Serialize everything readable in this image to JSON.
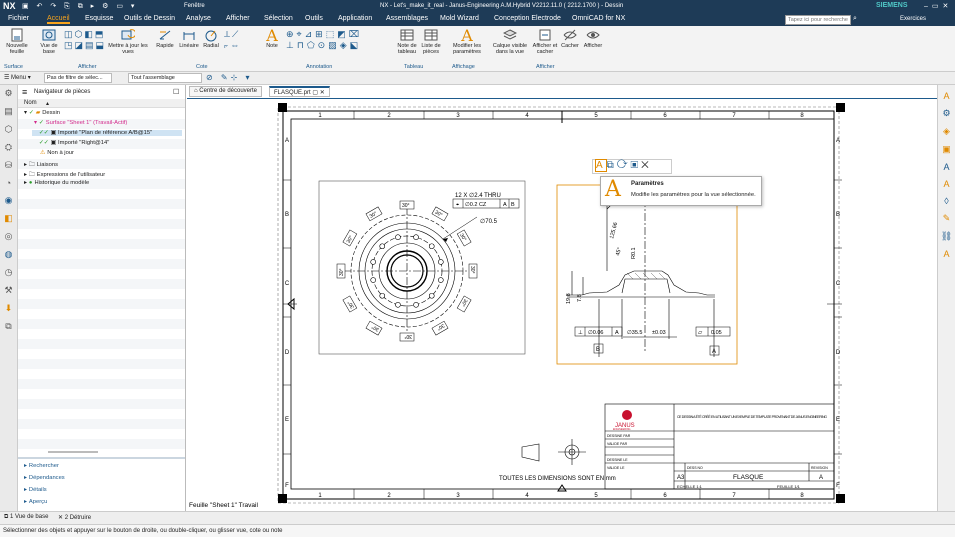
{
  "titlebar": {
    "app": "NX",
    "window_menu": "Fenêtre",
    "title": "NX - Let's_make_it_real - Janus-Engineering A.M.Hybrid V2212.11.0 ( 2212.1700 ) - Dessin",
    "brand": "SIEMENS"
  },
  "menubar": {
    "items": [
      "Fichier",
      "Accueil",
      "Esquisse",
      "Outils de Dessin",
      "Analyse",
      "Afficher",
      "Sélection",
      "Outils",
      "Application",
      "Assemblages",
      "Mold Wizard",
      "Conception Electrode",
      "OmniCAD for NX"
    ],
    "search_placeholder": "Tapez ici pour rechercher",
    "exercices": "Exercices"
  },
  "ribbon": {
    "buttons": [
      "Nouvelle feuille",
      "Vue de base",
      "Mettre à jour les vues",
      "Rapide",
      "Linéaire",
      "Radial",
      "Note",
      "Note de tableau",
      "Liste de pièces",
      "Modifier les paramètres",
      "Calque visible dans la vue",
      "Afficher et cacher",
      "Cacher",
      "Afficher"
    ],
    "groups": [
      "Surface",
      "Afficher",
      "Cote",
      "Annotation",
      "Tableau",
      "Affichage",
      "Afficher"
    ]
  },
  "filterbar": {
    "menu": "Menu",
    "filter": "Pas de filtre de sélec...",
    "scope": "Tout l'assemblage"
  },
  "tabs": [
    "Centre de découverte",
    "FLASQUE.prt"
  ],
  "navigator": {
    "title": "Navigateur de pièces",
    "col_name": "Nom",
    "tree": [
      "Dessin",
      "Surface \"Sheet 1\" (Travail-Actif)",
      "Importé \"Plan de référence A/B@15\"",
      "Importé \"Right@14\"",
      "Non à jour",
      "Liaisons",
      "Expressions de l'utilisateur",
      "Historique du modèle"
    ],
    "bottom_links": [
      "Rechercher",
      "Dépendances",
      "Détails",
      "Aperçu"
    ]
  },
  "tooltip": {
    "title": "Paramètres",
    "text": "Modifie les paramètres pour la vue sélectionnée."
  },
  "drawing": {
    "cols": [
      "1",
      "2",
      "3",
      "4",
      "5",
      "6",
      "7",
      "8"
    ],
    "rows": [
      "A",
      "B",
      "C",
      "D",
      "E",
      "F"
    ],
    "note_holes": "12 X ∅2.4 THRU",
    "fcf_pos": [
      "⌖",
      "∅0.2 CZ",
      "A",
      "B"
    ],
    "dim_70": "∅70.5",
    "angles": [
      "30°",
      "30°",
      "30°",
      "30°",
      "30°",
      "30°",
      "30°",
      "30°",
      "30°",
      "30°",
      "30°",
      "30°"
    ],
    "sec_dims": {
      "d125": "125.66",
      "d45": "45°",
      "r01": "R0.1",
      "h198": "19.8",
      "h78": "7.8",
      "d355": "∅35.5",
      "tol": "±0.03"
    },
    "fcf_perp": [
      "⊥",
      "∅0.06",
      "A"
    ],
    "fcf_flat": [
      "⏥",
      "0.05"
    ],
    "datums": [
      "B",
      "A"
    ],
    "footer_note": "TOUTES LES DIMENSIONS SONT EN  mm",
    "sheet_label": "Feuille \"Sheet 1\" Travail",
    "title_block": {
      "company": "JANUS",
      "sub": "ENGINEERING",
      "header": "CE DESSIN A ÉTÉ CRÉÉ EN UTILISANT UN EXEMPLE DE TEMPLATE PROVENANT DE JANUS ENGINEERING",
      "format": "A3",
      "name": "FLASQUE",
      "rev": "A",
      "scale": "ECHELLE 1:1",
      "sheet": "FEUILLE 1/1",
      "rows": [
        "DESSINE PAR",
        "VALIDE PAR",
        "DESSINE LE",
        "VALIDE LE"
      ],
      "labels": [
        "DESS NO",
        "REVISION"
      ]
    }
  },
  "bottombar": {
    "tabs": [
      "1 Vue de base",
      "2 Détruire"
    ]
  },
  "status": "Sélectionner des objets et appuyer sur le bouton de droite, ou double-cliquer, ou glisser vue, cote ou note"
}
